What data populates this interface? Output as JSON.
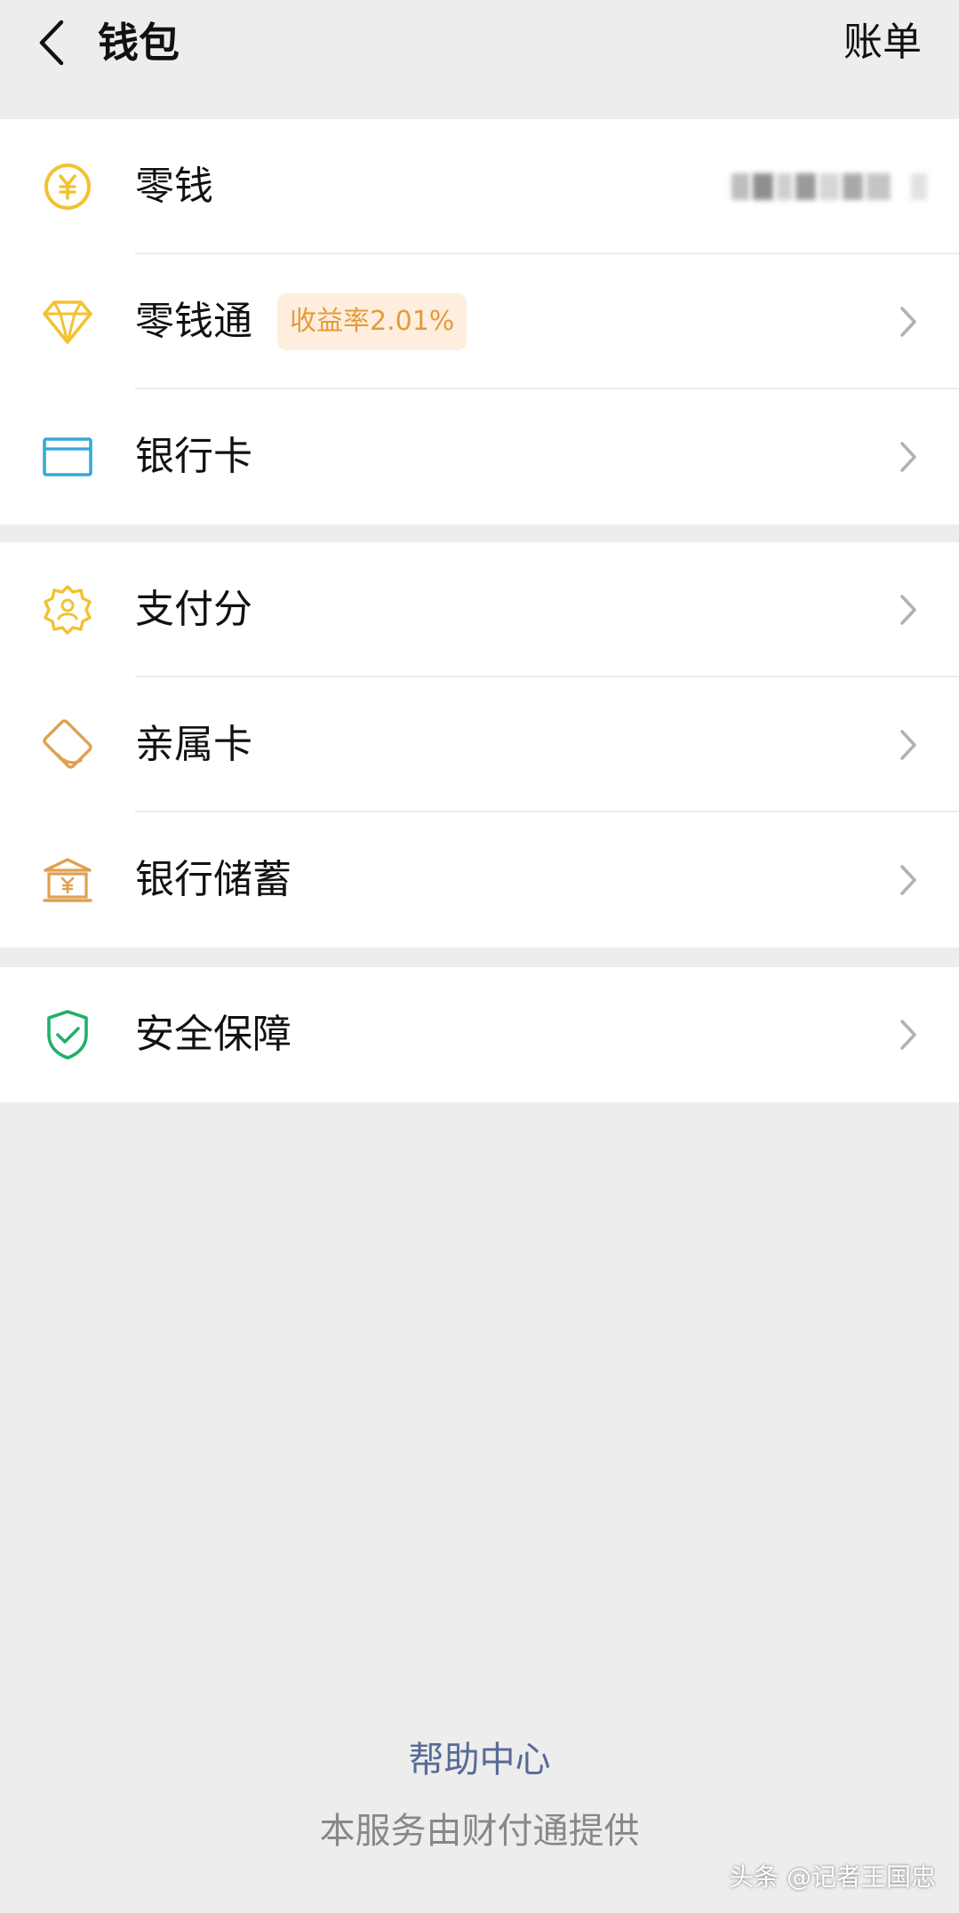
{
  "header": {
    "title": "钱包",
    "bill_label": "账单"
  },
  "groups": [
    {
      "items": [
        {
          "label": "零钱",
          "icon": "yen-coin-icon",
          "value_hidden": true
        },
        {
          "label": "零钱通",
          "icon": "diamond-icon",
          "badge": "收益率2.01%"
        },
        {
          "label": "银行卡",
          "icon": "bank-card-icon"
        }
      ]
    },
    {
      "items": [
        {
          "label": "支付分",
          "icon": "pay-score-badge-icon"
        },
        {
          "label": "亲属卡",
          "icon": "family-card-icon"
        },
        {
          "label": "银行储蓄",
          "icon": "bank-savings-icon"
        }
      ]
    },
    {
      "items": [
        {
          "label": "安全保障",
          "icon": "security-shield-icon"
        }
      ]
    }
  ],
  "footer": {
    "help_label": "帮助中心",
    "provider_text": "本服务由财付通提供"
  },
  "watermark": "头条 @记者王国忠",
  "colors": {
    "background": "#ededed",
    "card": "#ffffff",
    "yellow_icon": "#f2c230",
    "orange_icon": "#e0a050",
    "blue_icon": "#35a8d8",
    "green_icon": "#22b06a",
    "link": "#576b95",
    "badge_bg": "#fdeedd",
    "badge_text": "#e59a3c"
  }
}
